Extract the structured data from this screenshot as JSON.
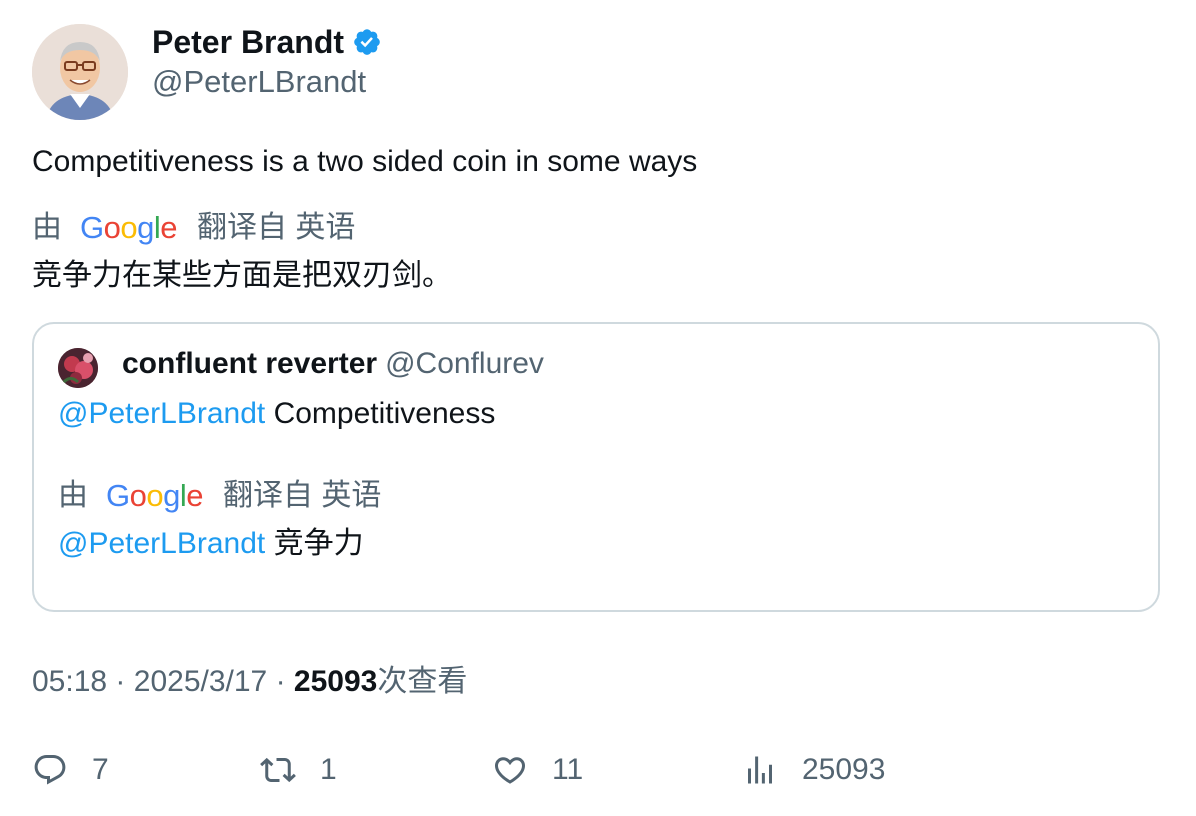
{
  "author": {
    "name": "Peter Brandt",
    "handle": "@PeterLBrandt",
    "avatar_icon": "cartoon-portrait-avatar",
    "verified_icon": "verified-badge-icon"
  },
  "tweet": {
    "text": "Competitiveness is a two sided coin in some ways",
    "translation": {
      "by": "由",
      "google_letters": [
        "G",
        "o",
        "o",
        "g",
        "l",
        "e"
      ],
      "translated_from": "翻译自 英语",
      "text": "竞争力在某些方面是把双刃剑。"
    }
  },
  "quote": {
    "name": "confluent reverter",
    "handle": "@Conflurev",
    "mention": "@PeterLBrandt",
    "text": "Competitiveness",
    "translation": {
      "by": "由",
      "translated_from": "翻译自 英语",
      "mention": "@PeterLBrandt",
      "text": "竞争力"
    }
  },
  "meta": {
    "time": "05:18",
    "sep": "·",
    "date": "2025/3/17",
    "views_count": "25093",
    "views_label": "次查看"
  },
  "actions": {
    "replies": "7",
    "reposts": "1",
    "likes": "11",
    "views": "25093"
  },
  "colors": {
    "accent": "#1d9bf0",
    "secondary_text": "#536471",
    "border": "#cfd9de",
    "google_blue": "#4285f4",
    "google_red": "#ea4335",
    "google_yellow": "#fbbc05",
    "google_green": "#34a853"
  }
}
